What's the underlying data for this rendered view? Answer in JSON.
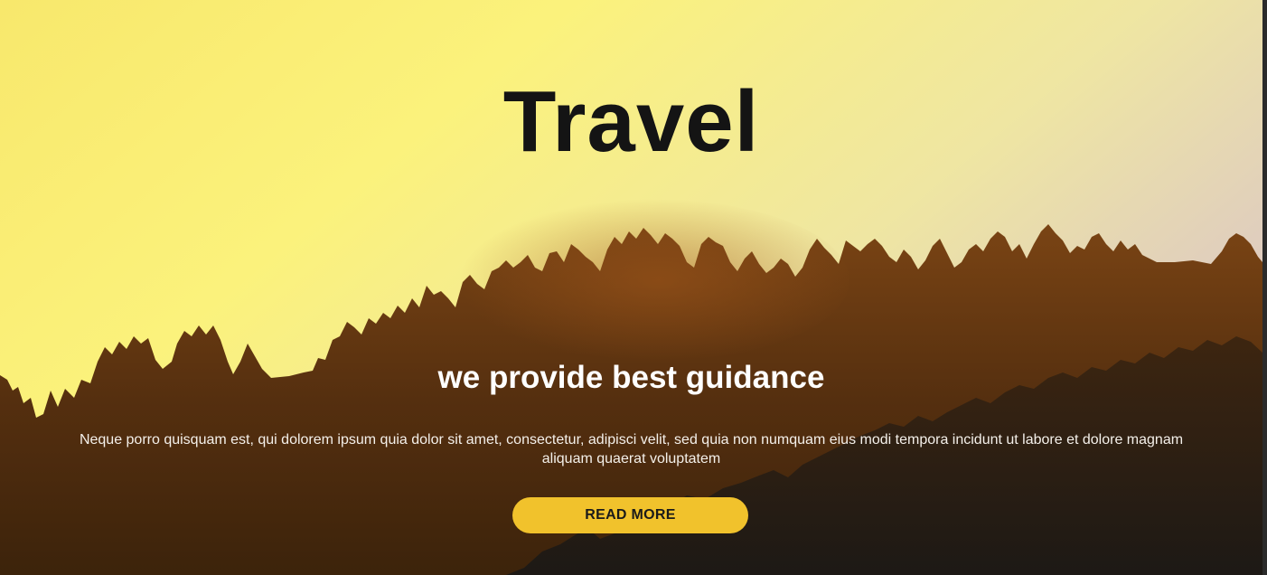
{
  "hero": {
    "title": "Travel",
    "subtitle": "we provide best guidance",
    "description": "Neque porro quisquam est, qui dolorem ipsum quia dolor sit amet, consectetur, adipisci velit, sed quia non numquam eius modi tempora incidunt ut labore et dolore magnam aliquam quaerat voluptatem",
    "button_label": "READ MORE"
  },
  "colors": {
    "sky_top": "#dcc8c4",
    "sky_bottom": "#fbf27a",
    "forest_far": "#6b3c12",
    "forest_near": "#2c1708",
    "accent_button": "#f1c22c",
    "title_text": "#141414"
  }
}
